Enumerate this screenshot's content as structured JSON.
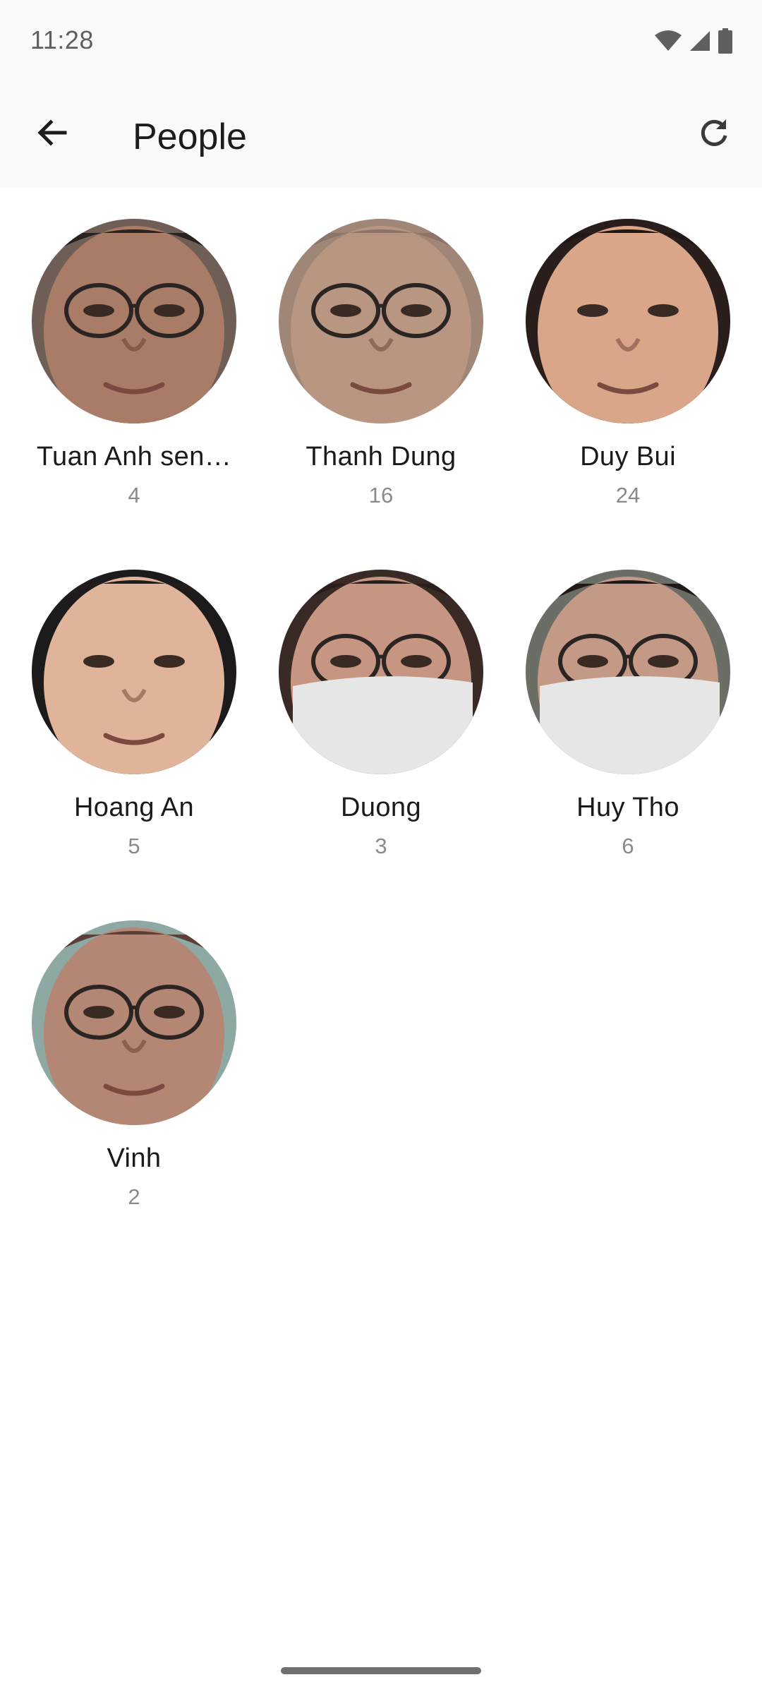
{
  "status_bar": {
    "time": "11:28",
    "icons": [
      "wifi-icon",
      "signal-icon",
      "battery-icon"
    ]
  },
  "app_bar": {
    "title": "People",
    "back_icon": "arrow-left-icon",
    "refresh_icon": "refresh-icon"
  },
  "people": [
    {
      "name": "Tuan Anh sen…",
      "count": "4",
      "skin": "#a87c66",
      "bg": "#6e5e55",
      "hair": "#2a2220",
      "glasses": true,
      "mask": false
    },
    {
      "name": "Thanh Dung",
      "count": "16",
      "skin": "#b89682",
      "bg": "#a08676",
      "hair": "#8c7468",
      "glasses": true,
      "mask": false
    },
    {
      "name": "Duy Bui",
      "count": "24",
      "skin": "#d9a68a",
      "bg": "#2a1e1c",
      "hair": "#201816",
      "glasses": false,
      "mask": false
    },
    {
      "name": "Hoang An",
      "count": "5",
      "skin": "#e0b49a",
      "bg": "#1c1a1a",
      "hair": "#241c1a",
      "glasses": false,
      "mask": false
    },
    {
      "name": "Duong",
      "count": "3",
      "skin": "#c69682",
      "bg": "#3a2a26",
      "hair": "#2a1e1c",
      "glasses": true,
      "mask": true
    },
    {
      "name": "Huy Tho",
      "count": "6",
      "skin": "#c49a86",
      "bg": "#6a6e66",
      "hair": "#221a18",
      "glasses": true,
      "mask": true
    },
    {
      "name": "Vinh",
      "count": "2",
      "skin": "#b48674",
      "bg": "#8ea8a4",
      "hair": "#5a4038",
      "glasses": true,
      "mask": false
    }
  ]
}
